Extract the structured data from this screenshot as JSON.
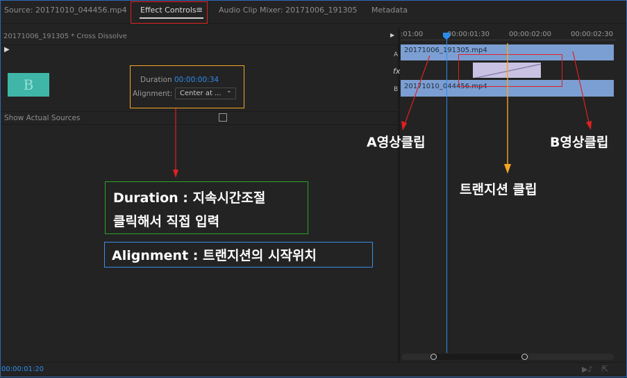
{
  "tabs": {
    "source": "Source: 20171010_044456.mp4",
    "effect_controls": "Effect Controls",
    "audio_mixer": "Audio Clip Mixer: 20171006_191305",
    "metadata": "Metadata"
  },
  "effect_panel": {
    "clip_title": "20171006_191305 * Cross Dissolve",
    "thumb_letter": "B",
    "duration_label": "Duration",
    "duration_value": "00:00:00:34",
    "alignment_label": "Alignment:",
    "alignment_value": "Center at ...",
    "show_actual_sources": "Show Actual Sources"
  },
  "timeline": {
    "ticks": [
      ":01:00",
      "00:00:01:30",
      "00:00:02:00",
      "00:00:02:30"
    ],
    "track_a": "A",
    "track_b": "B",
    "fx": "fx",
    "clip_a": "20171006_191305.mp4",
    "clip_b": "20171010_044456.mp4"
  },
  "footer": {
    "current_time": "00:00:01:20"
  },
  "annotations": {
    "duration_line1": "Duration : 지속시간조절",
    "duration_line2": "클릭해서 직접 입력",
    "alignment": "Alignment : 트랜지션의 시작위치",
    "a_clip": "A영상클립",
    "b_clip": "B영상클립",
    "transition_clip": "트랜지션 클립"
  },
  "colors": {
    "accent": "#2d8ceb",
    "clip": "#7c9fd3",
    "transition": "#c9c2e2",
    "anno_red": "#e02020",
    "anno_orange": "#f5a623",
    "anno_green": "#2aa52a",
    "anno_blue": "#3a8ee6"
  }
}
